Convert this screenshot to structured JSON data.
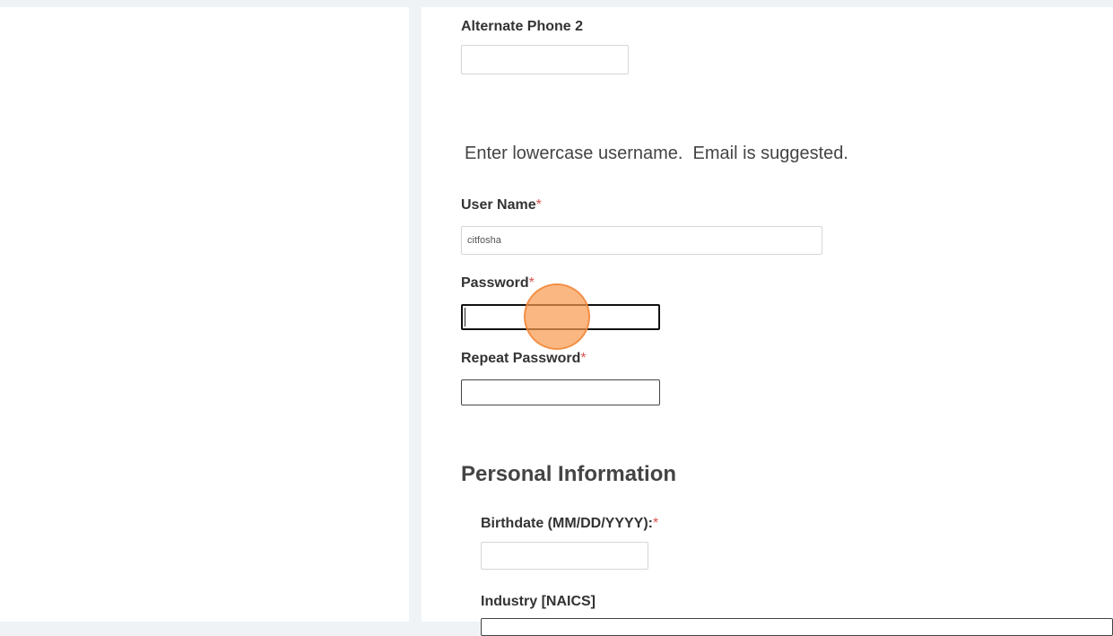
{
  "form": {
    "alt_phone2": {
      "label": "Alternate Phone 2",
      "value": ""
    },
    "username_instruction": "Enter lowercase username.  Email is suggested.",
    "username": {
      "label": "User Name",
      "required_mark": "*",
      "value": "citfosha"
    },
    "password": {
      "label": "Password",
      "required_mark": "*",
      "value": ""
    },
    "repeat_password": {
      "label": "Repeat Password",
      "required_mark": "*",
      "value": ""
    },
    "personal_section_title": "Personal Information",
    "birthdate": {
      "label": "Birthdate (MM/DD/YYYY):",
      "required_mark": "*",
      "value": ""
    },
    "industry": {
      "label": "Industry [NAICS]",
      "value": ""
    }
  },
  "colors": {
    "required": "#d9534f",
    "click_marker": "#f8994d"
  }
}
